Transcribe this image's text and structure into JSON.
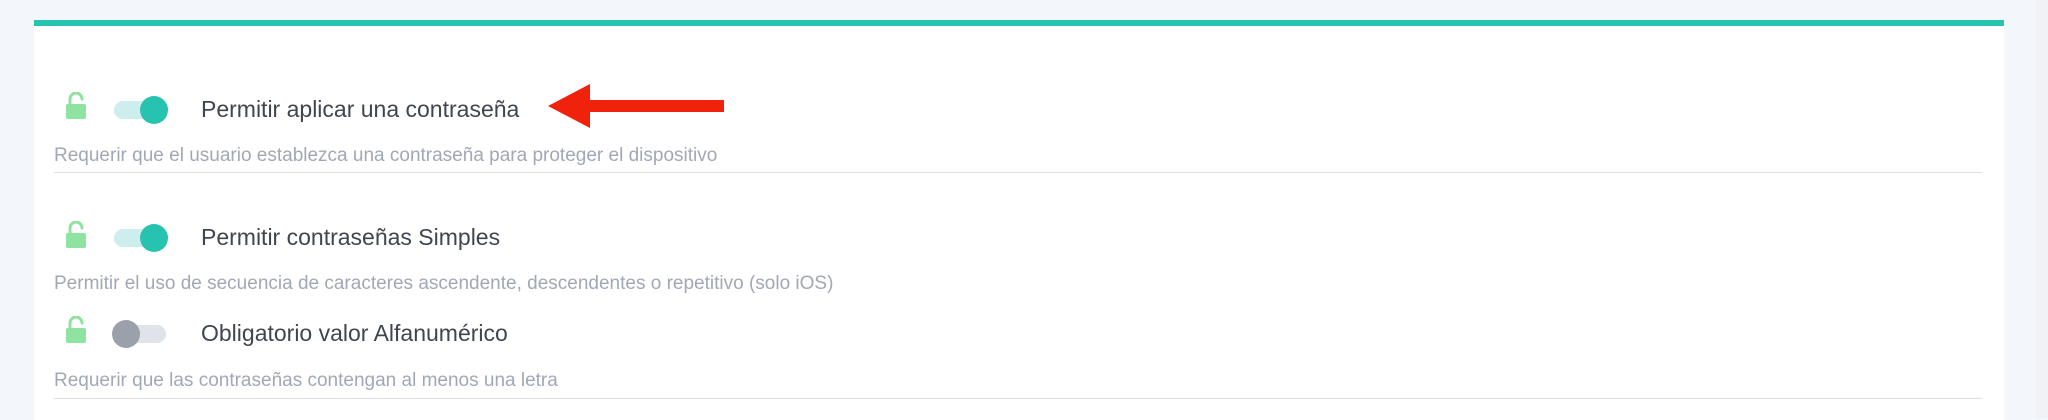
{
  "settings": [
    {
      "label": "Permitir aplicar una contraseña",
      "description": "Requerir que el usuario establezca una contraseña para proteger el dispositivo",
      "enabled": true,
      "lock_icon": "unlocked-padlock-icon"
    },
    {
      "label": "Permitir contraseñas Simples",
      "description": "Permitir el uso de secuencia de caracteres ascendente, descendentes o repetitivo (solo iOS)",
      "enabled": true,
      "lock_icon": "unlocked-padlock-icon"
    },
    {
      "label": "Obligatorio valor Alfanumérico",
      "description": "Requerir que las contraseñas contengan al menos una letra",
      "enabled": false,
      "lock_icon": "unlocked-padlock-icon"
    }
  ],
  "annotation": {
    "icon": "red-arrow-icon",
    "color": "#f0220c"
  },
  "colors": {
    "accent": "#27c3b0",
    "lock": "#8fe3a0",
    "toggle_off_knob": "#9aa1ab"
  }
}
